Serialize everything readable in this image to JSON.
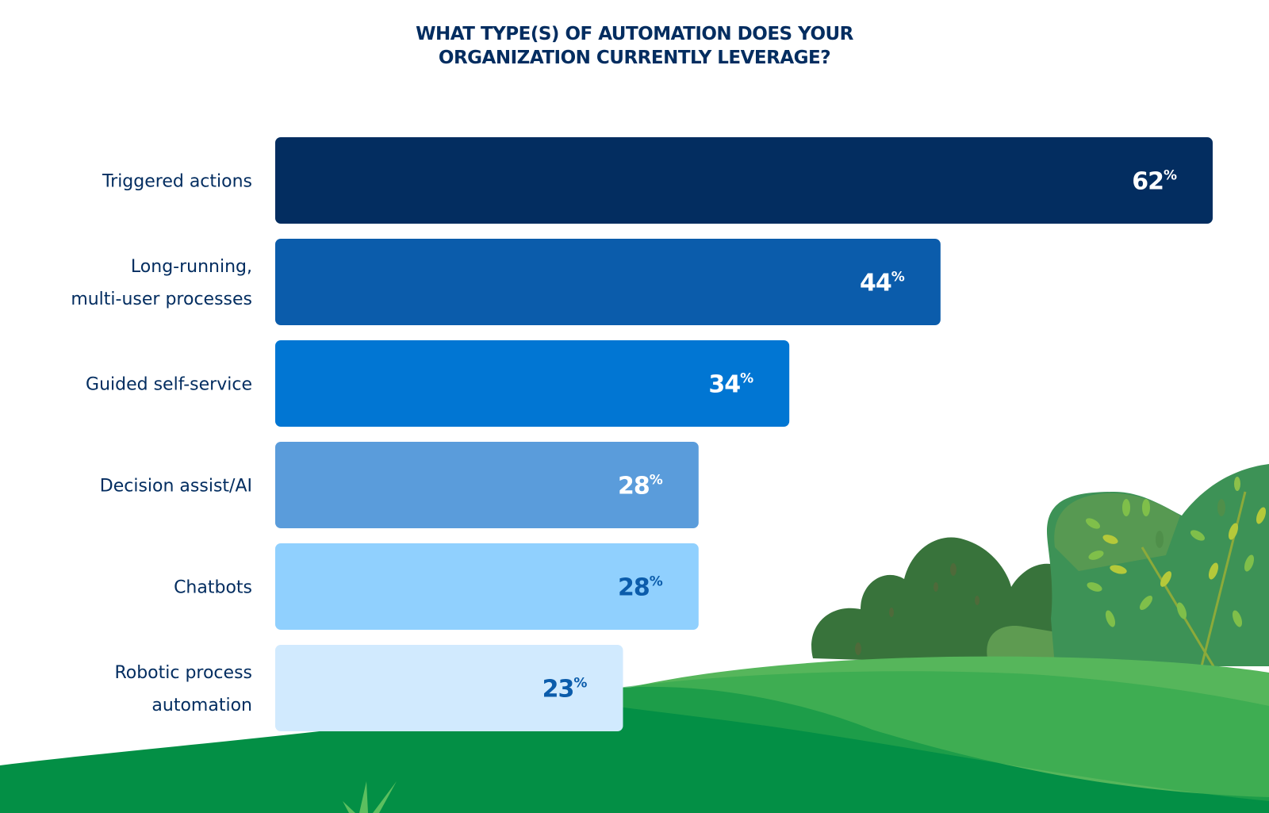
{
  "title_lines": [
    "WHAT TYPE(S) OF AUTOMATION DOES YOUR",
    "ORGANIZATION CURRENTLY LEVERAGE?"
  ],
  "chart_data": {
    "type": "bar",
    "orientation": "horizontal",
    "title": "WHAT TYPE(S) OF AUTOMATION DOES YOUR ORGANIZATION CURRENTLY LEVERAGE?",
    "xlabel": "",
    "ylabel": "",
    "unit": "%",
    "xlim": [
      0,
      62
    ],
    "grid": false,
    "legend": "none",
    "categories": [
      [
        "Triggered actions"
      ],
      [
        "Long-running,",
        "multi-user processes"
      ],
      [
        "Guided self-service"
      ],
      [
        "Decision assist/AI"
      ],
      [
        "Chatbots"
      ],
      [
        "Robotic process",
        "automation"
      ]
    ],
    "values": [
      62,
      44,
      34,
      28,
      28,
      23
    ],
    "value_labels": [
      "62",
      "44",
      "34",
      "28",
      "28",
      "23"
    ],
    "bar_colors": [
      "#032d60",
      "#0b5cab",
      "#0176d3",
      "#5a9cdb",
      "#90d0fe",
      "#d1eafe"
    ],
    "label_colors": [
      "#ffffff",
      "#ffffff",
      "#ffffff",
      "#ffffff",
      "#0b5cab",
      "#0b5cab"
    ]
  }
}
